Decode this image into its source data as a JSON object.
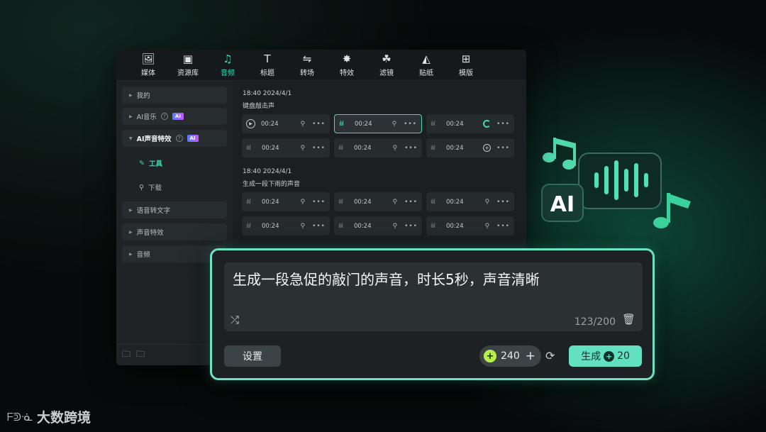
{
  "toolbar": {
    "items": [
      {
        "label": "媒体",
        "icon": "image-icon",
        "glyph": "🖼"
      },
      {
        "label": "资源库",
        "icon": "library-icon",
        "glyph": "▣"
      },
      {
        "label": "音频",
        "icon": "music-icon",
        "glyph": "♫"
      },
      {
        "label": "标题",
        "icon": "text-icon",
        "glyph": "T"
      },
      {
        "label": "转场",
        "icon": "transition-icon",
        "glyph": "⇋"
      },
      {
        "label": "特效",
        "icon": "effects-icon",
        "glyph": "✸"
      },
      {
        "label": "滤镜",
        "icon": "filter-icon",
        "glyph": "☘"
      },
      {
        "label": "贴纸",
        "icon": "sticker-icon",
        "glyph": "◭"
      },
      {
        "label": "模版",
        "icon": "template-icon",
        "glyph": "⊞"
      }
    ],
    "active_index": 2
  },
  "sidebar": {
    "items": [
      {
        "label": "我的"
      },
      {
        "label": "AI音乐",
        "badge": "AI"
      },
      {
        "label": "AI声音特效",
        "badge": "AI"
      },
      {
        "label": "语音转文字"
      },
      {
        "label": "声音特效"
      },
      {
        "label": "音频"
      }
    ],
    "sub_items": [
      {
        "label": "工具"
      },
      {
        "label": "下载"
      }
    ]
  },
  "groups": [
    {
      "time": "18:40 2024/4/1",
      "title": "键盘敲击声",
      "cards": [
        "00:24",
        "00:24",
        "00:24",
        "00:24",
        "00:24",
        "00:24"
      ]
    },
    {
      "time": "18:40 2024/4/1",
      "title": "生成一段下雨的声音",
      "cards": [
        "00:24",
        "00:24",
        "00:24",
        "00:24",
        "00:24",
        "00:24"
      ]
    }
  ],
  "prompt": {
    "text": "生成一段急促的敲门的声音，时长5秒，声音清晰",
    "counter": "123/200",
    "settings_label": "设置",
    "credits": "240",
    "generate_label": "生成",
    "generate_cost": "20"
  },
  "decoration": {
    "badge_text": "AI"
  },
  "watermark": {
    "text": "大数跨境"
  },
  "colors": {
    "accent": "#3fd9b3",
    "generate": "#62e0bf",
    "coin": "#b8f04a"
  }
}
